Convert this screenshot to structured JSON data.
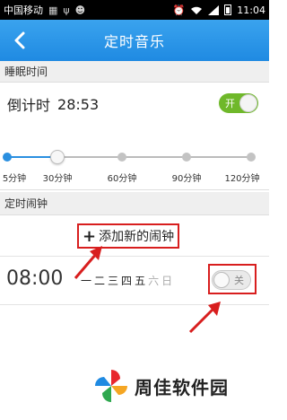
{
  "status_bar": {
    "carrier": "中国移动",
    "time": "11:04",
    "icons": [
      "grid-icon",
      "usb-icon",
      "android-icon",
      "alarm-icon",
      "wifi-icon",
      "signal-icon",
      "battery-icon"
    ]
  },
  "header": {
    "title": "定时音乐",
    "back_icon": "chevron-left-icon",
    "background": "#2a93e8"
  },
  "sleep": {
    "section_title": "睡眠时间",
    "countdown_label": "倒计时",
    "countdown_value": "28:53",
    "toggle_label": "开",
    "toggle_on": true,
    "toggle_color": "#6fb82a"
  },
  "slider": {
    "selected": "30分钟",
    "accent": "#2a8fe0",
    "options": [
      "5分钟",
      "30分钟",
      "60分钟",
      "90分钟",
      "120分钟"
    ]
  },
  "alarm": {
    "section_title": "定时闹钟",
    "add_label": "添加新的闹钟",
    "time": "08:00",
    "days": [
      "一",
      "二",
      "三",
      "四",
      "五",
      "六",
      "日"
    ],
    "days_active": [
      true,
      true,
      true,
      true,
      true,
      false,
      false
    ],
    "toggle_label": "关",
    "toggle_on": false,
    "highlight_color": "#d81e1e"
  },
  "watermark": {
    "text": "周佳软件园"
  }
}
